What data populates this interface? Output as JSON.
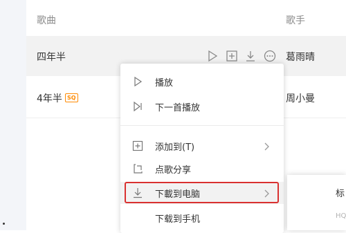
{
  "header": {
    "song_col": "歌曲",
    "artist_col": "歌手"
  },
  "songs": [
    {
      "title": "四年半",
      "artist": "葛雨晴"
    },
    {
      "title": "4年半",
      "badge": "SQ",
      "artist": "周小曼"
    }
  ],
  "context_menu": {
    "items": [
      {
        "label": "播放",
        "icon": "play-icon"
      },
      {
        "label": "下一首播放",
        "icon": "play-next-icon"
      },
      {
        "label": "添加到(T)",
        "icon": "add-icon"
      },
      {
        "label": "点歌分享",
        "icon": "share-icon"
      },
      {
        "label": "下載到电脑",
        "icon": "download-icon"
      },
      {
        "label": "下载到手机",
        "icon": "phone-icon"
      }
    ]
  },
  "submenu": {
    "item1": "标",
    "item2": "HQ"
  },
  "colors": {
    "highlight_border": "#d9302f",
    "sq_badge": "#ff8a00"
  }
}
